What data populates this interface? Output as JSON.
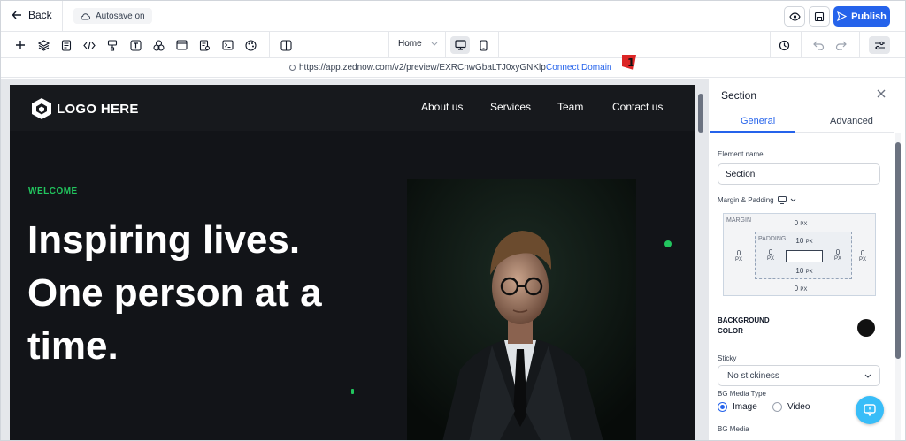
{
  "topbar": {
    "back_label": "Back",
    "autosave_label": "Autosave on",
    "publish_label": "Publish",
    "preview_icon": "eye-icon",
    "save_icon": "save-icon"
  },
  "toolbar": {
    "icons": [
      "plus-icon",
      "layers-icon",
      "page-icon",
      "code-icon",
      "paint-icon",
      "text-icon",
      "shapes-icon",
      "layout-icon",
      "form-icon",
      "terminal-icon",
      "palette-icon",
      "split-icon"
    ],
    "page_select_value": "Home",
    "devices": [
      "desktop-icon",
      "mobile-icon"
    ],
    "right_icons": [
      "history-icon",
      "undo-icon",
      "redo-icon",
      "settings-sliders-icon"
    ]
  },
  "urlbar": {
    "url": "https://app.zednow.com/v2/preview/EXRCnwGbaLTJ0xyGNKlp",
    "connect_label": "Connect Domain",
    "annotation_number": "1"
  },
  "site": {
    "logo_text": "LOGO HERE",
    "nav": [
      "About us",
      "Services",
      "Team",
      "Contact us"
    ],
    "welcome": "WELCOME",
    "headline": "Inspiring lives. One person at a time.",
    "accent_color": "#22c55e"
  },
  "panel": {
    "title": "Section",
    "tabs": [
      "General",
      "Advanced"
    ],
    "element_name_label": "Element name",
    "element_name_value": "Section",
    "margin_padding_label": "Margin & Padding",
    "margin_label": "MARGIN",
    "padding_label": "PADDING",
    "margin": {
      "top": "0",
      "right": "0",
      "bottom": "0",
      "left": "0"
    },
    "padding": {
      "top": "10",
      "right": "0",
      "bottom": "10",
      "left": "0"
    },
    "unit": "PX",
    "bg_color_label": "BACKGROUND COLOR",
    "bg_color_value": "#111111",
    "sticky_label": "Sticky",
    "sticky_value": "No stickiness",
    "bg_media_type_label": "BG Media Type",
    "media_options": [
      "Image",
      "Video"
    ],
    "media_selected": "Image",
    "bg_media_label": "BG Media"
  }
}
